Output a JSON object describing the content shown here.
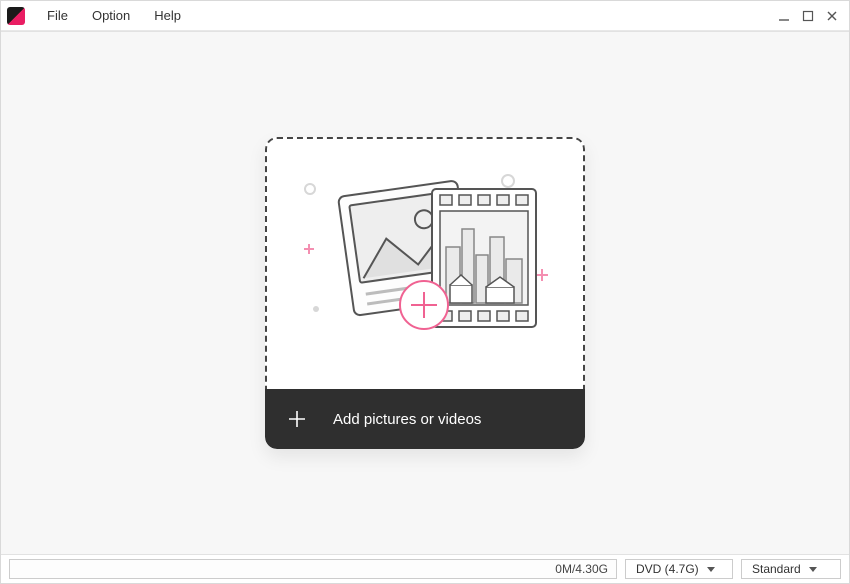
{
  "menu": {
    "file": "File",
    "option": "Option",
    "help": "Help"
  },
  "drop": {
    "add_label": "Add pictures or videos"
  },
  "bottom": {
    "capacity_text": "0M/4.30G",
    "disc_select": "DVD (4.7G)",
    "quality_select": "Standard"
  }
}
